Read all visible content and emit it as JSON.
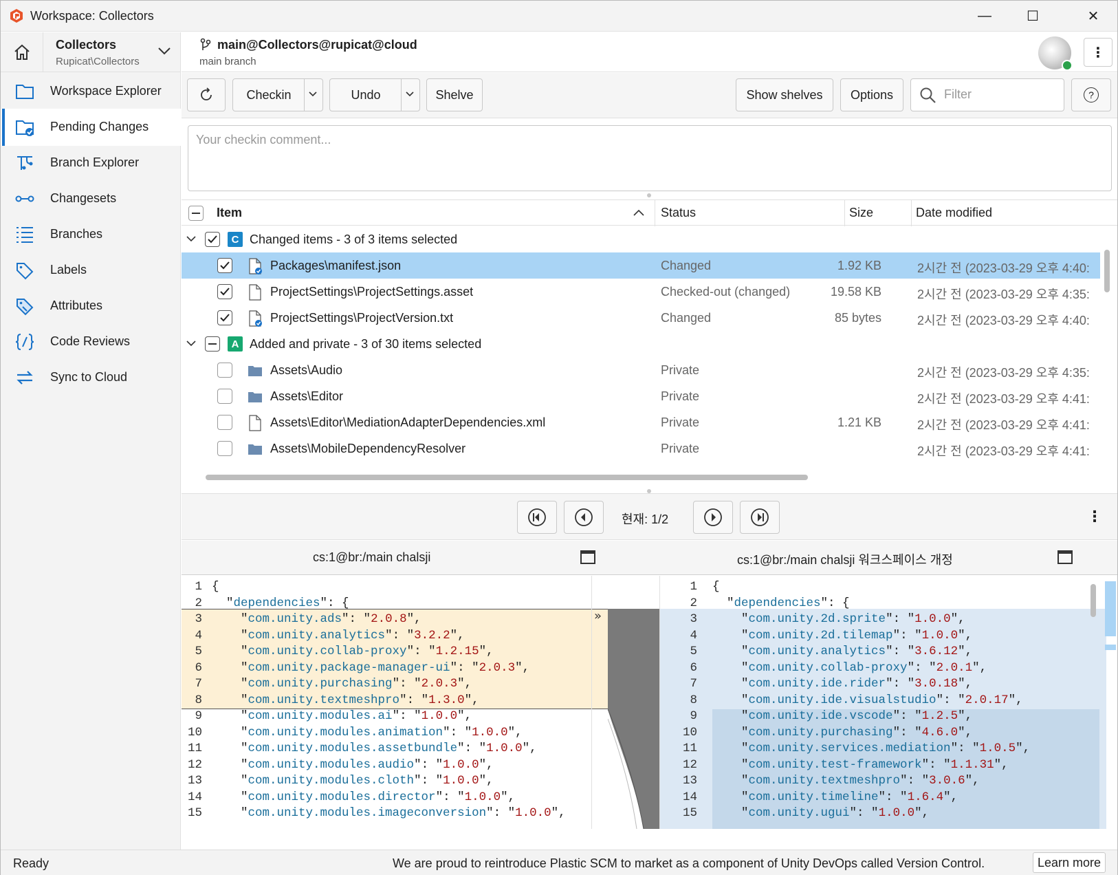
{
  "window": {
    "title": "Workspace: Collectors",
    "minimize": "—",
    "maximize": "☐",
    "close": "✕"
  },
  "workspace": {
    "name": "Collectors",
    "path": "Rupicat\\Collectors"
  },
  "branch": {
    "name": "main@Collectors@rupicat@cloud",
    "sub": "main branch"
  },
  "sidebar": {
    "items": [
      {
        "label": "Workspace Explorer",
        "icon": "folder-icon"
      },
      {
        "label": "Pending Changes",
        "icon": "pending-changes-icon",
        "active": true
      },
      {
        "label": "Branch Explorer",
        "icon": "branch-explorer-icon"
      },
      {
        "label": "Changesets",
        "icon": "changesets-icon"
      },
      {
        "label": "Branches",
        "icon": "branches-icon"
      },
      {
        "label": "Labels",
        "icon": "label-icon"
      },
      {
        "label": "Attributes",
        "icon": "attributes-icon"
      },
      {
        "label": "Code Reviews",
        "icon": "code-review-icon"
      },
      {
        "label": "Sync to Cloud",
        "icon": "sync-icon"
      }
    ]
  },
  "toolbar": {
    "checkin": "Checkin",
    "undo": "Undo",
    "shelve": "Shelve",
    "show_shelves": "Show shelves",
    "options": "Options",
    "filter_placeholder": "Filter",
    "help": "?"
  },
  "comment": {
    "placeholder": "Your checkin comment..."
  },
  "columns": {
    "item": "Item",
    "status": "Status",
    "size": "Size",
    "date": "Date modified"
  },
  "groups": [
    {
      "tag": "C",
      "label": "Changed items - 3 of 3 items selected",
      "color": "#1a86c8"
    },
    {
      "tag": "A",
      "label": "Added and private - 3 of 30 items selected",
      "color": "#17a870"
    }
  ],
  "rows": [
    {
      "name": "Packages\\manifest.json",
      "status": "Changed",
      "size": "1.92 KB",
      "date": "2시간 전 (2023-03-29 오후 4:40:",
      "checked": true,
      "type": "file-changed",
      "selected": true
    },
    {
      "name": "ProjectSettings\\ProjectSettings.asset",
      "status": "Checked-out (changed)",
      "size": "19.58 KB",
      "date": "2시간 전 (2023-03-29 오후 4:35:",
      "checked": true,
      "type": "file"
    },
    {
      "name": "ProjectSettings\\ProjectVersion.txt",
      "status": "Changed",
      "size": "85 bytes",
      "date": "2시간 전 (2023-03-29 오후 4:40:",
      "checked": true,
      "type": "file-changed"
    },
    {
      "name": "Assets\\Audio",
      "status": "Private",
      "size": "",
      "date": "2시간 전 (2023-03-29 오후 4:35:",
      "checked": false,
      "type": "folder"
    },
    {
      "name": "Assets\\Editor",
      "status": "Private",
      "size": "",
      "date": "2시간 전 (2023-03-29 오후 4:41:",
      "checked": false,
      "type": "folder"
    },
    {
      "name": "Assets\\Editor\\MediationAdapterDependencies.xml",
      "status": "Private",
      "size": "1.21 KB",
      "date": "2시간 전 (2023-03-29 오후 4:41:",
      "checked": false,
      "type": "file"
    },
    {
      "name": "Assets\\MobileDependencyResolver",
      "status": "Private",
      "size": "",
      "date": "2시간 전 (2023-03-29 오후 4:41:",
      "checked": false,
      "type": "folder"
    }
  ],
  "navigator": {
    "current": "현재: 1/2"
  },
  "diff": {
    "left_title": "cs:1@br:/main chalsji",
    "right_title": "cs:1@br:/main chalsji 워크스페이스 개정",
    "left": [
      {
        "n": "1",
        "key": "",
        "val": "",
        "raw": "{"
      },
      {
        "n": "2",
        "key": "dependencies",
        "val": "",
        "raw": "obj"
      },
      {
        "n": "3",
        "key": "com.unity.ads",
        "val": "2.0.8"
      },
      {
        "n": "4",
        "key": "com.unity.analytics",
        "val": "3.2.2"
      },
      {
        "n": "5",
        "key": "com.unity.collab-proxy",
        "val": "1.2.15"
      },
      {
        "n": "6",
        "key": "com.unity.package-manager-ui",
        "val": "2.0.3"
      },
      {
        "n": "7",
        "key": "com.unity.purchasing",
        "val": "2.0.3"
      },
      {
        "n": "8",
        "key": "com.unity.textmeshpro",
        "val": "1.3.0"
      },
      {
        "n": "9",
        "key": "com.unity.modules.ai",
        "val": "1.0.0"
      },
      {
        "n": "10",
        "key": "com.unity.modules.animation",
        "val": "1.0.0"
      },
      {
        "n": "11",
        "key": "com.unity.modules.assetbundle",
        "val": "1.0.0"
      },
      {
        "n": "12",
        "key": "com.unity.modules.audio",
        "val": "1.0.0"
      },
      {
        "n": "13",
        "key": "com.unity.modules.cloth",
        "val": "1.0.0"
      },
      {
        "n": "14",
        "key": "com.unity.modules.director",
        "val": "1.0.0"
      },
      {
        "n": "15",
        "key": "com.unity.modules.imageconversion",
        "val": "1.0.0"
      }
    ],
    "right": [
      {
        "n": "1",
        "key": "",
        "val": "",
        "raw": "{"
      },
      {
        "n": "2",
        "key": "dependencies",
        "val": "",
        "raw": "obj"
      },
      {
        "n": "3",
        "key": "com.unity.2d.sprite",
        "val": "1.0.0"
      },
      {
        "n": "4",
        "key": "com.unity.2d.tilemap",
        "val": "1.0.0"
      },
      {
        "n": "5",
        "key": "com.unity.analytics",
        "val": "3.6.12"
      },
      {
        "n": "6",
        "key": "com.unity.collab-proxy",
        "val": "2.0.1"
      },
      {
        "n": "7",
        "key": "com.unity.ide.rider",
        "val": "3.0.18"
      },
      {
        "n": "8",
        "key": "com.unity.ide.visualstudio",
        "val": "2.0.17"
      },
      {
        "n": "9",
        "key": "com.unity.ide.vscode",
        "val": "1.2.5"
      },
      {
        "n": "10",
        "key": "com.unity.purchasing",
        "val": "4.6.0"
      },
      {
        "n": "11",
        "key": "com.unity.services.mediation",
        "val": "1.0.5"
      },
      {
        "n": "12",
        "key": "com.unity.test-framework",
        "val": "1.1.31"
      },
      {
        "n": "13",
        "key": "com.unity.textmeshpro",
        "val": "3.0.6"
      },
      {
        "n": "14",
        "key": "com.unity.timeline",
        "val": "1.6.4"
      },
      {
        "n": "15",
        "key": "com.unity.ugui",
        "val": "1.0.0"
      }
    ]
  },
  "status": {
    "text": "Ready",
    "message": "We are proud to reintroduce Plastic SCM to market as a component of Unity DevOps called Version Control.",
    "learn_more": "Learn more"
  },
  "colors": {
    "accent": "#1a73c9",
    "selection": "#a9d4f5",
    "changed_bg": "#fdf0d5",
    "added_bg": "#dce8f4",
    "added_dark": "#c4d8ea"
  }
}
